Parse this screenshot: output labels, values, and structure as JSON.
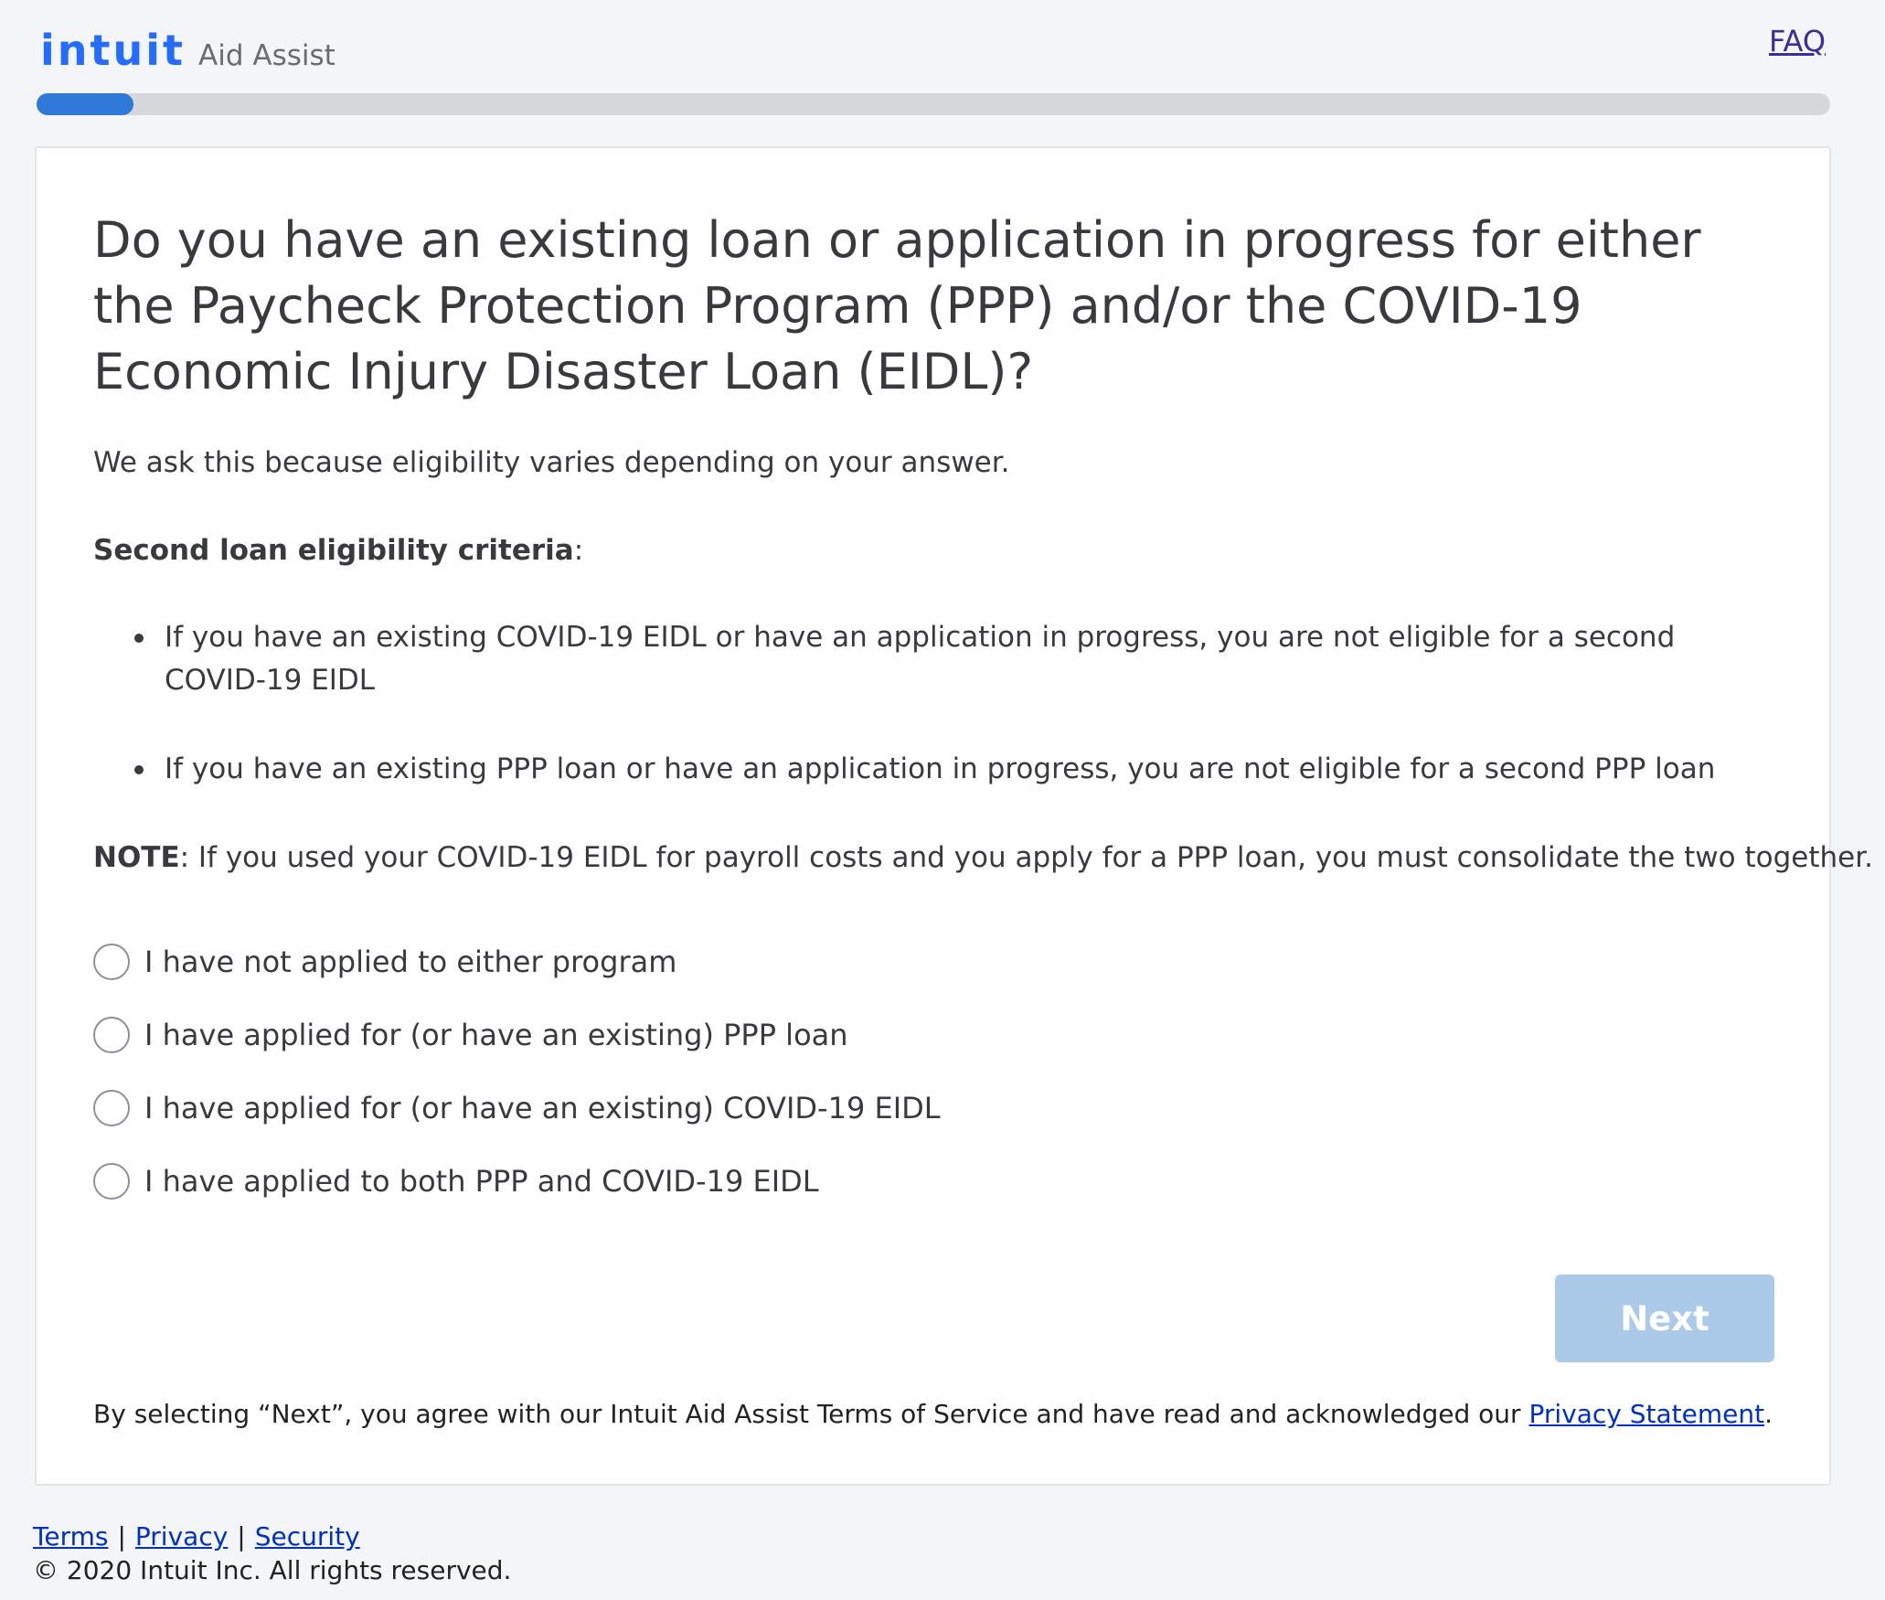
{
  "header": {
    "logo_word": "intuit",
    "logo_sub": "Aid Assist",
    "faq_label": "FAQ"
  },
  "progress": {
    "fraction": 0.054
  },
  "question": {
    "title": "Do you have an existing loan or application in progress for either the Paycheck Protection Program (PPP) and/or the COVID-19 Economic Injury Disaster Loan (EIDL)?",
    "reason": "We ask this because eligibility varies depending on your answer.",
    "criteria_heading": "Second loan eligibility criteria",
    "criteria_suffix": ":",
    "bullets": [
      "If you have an existing COVID-19 EIDL or have an application in progress, you are not eligible for a second COVID-19 EIDL",
      "If you have an existing PPP loan or have an application in progress, you are not eligible for a second PPP loan"
    ],
    "note_label": "NOTE",
    "note_text": ": If you used your COVID-19 EIDL for payroll costs and you apply for a PPP loan, you must consolidate the two together.",
    "options": [
      "I have not applied to either program",
      "I have applied for (or have an existing) PPP loan",
      "I have applied for (or have an existing) COVID-19 EIDL",
      "I have applied to both PPP and COVID-19 EIDL"
    ]
  },
  "next_button": {
    "label": "Next",
    "enabled": false
  },
  "agreement": {
    "text": "By selecting “Next”, you agree with our Intuit Aid Assist Terms of Service and have read and acknowledged our ",
    "link": "Privacy Statement",
    "end": "."
  },
  "footer": {
    "links": [
      "Terms",
      "Privacy",
      "Security"
    ],
    "separator": "|",
    "copyright": "© 2020 Intuit Inc. All rights reserved."
  },
  "colors": {
    "brand": "#236cff",
    "progress": "#2f7ad8",
    "button_disabled": "#abc9e9",
    "link": "#0030c8"
  }
}
